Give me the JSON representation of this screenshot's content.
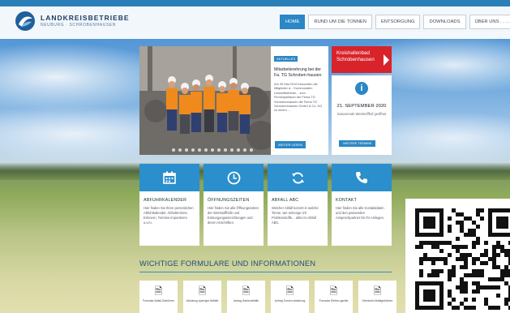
{
  "header": {
    "logo_title": "LANDKREISBETRIEBE",
    "logo_subtitle": "NEUBURG · SCHROBENHAUSEN"
  },
  "nav": [
    {
      "label": "HOME",
      "active": true
    },
    {
      "label": "RUND UM DIE TONNEN",
      "active": false
    },
    {
      "label": "ENTSORGUNG",
      "active": false
    },
    {
      "label": "DOWNLOADS",
      "active": false
    },
    {
      "label": "ÜBER UNS . . . . . . .",
      "active": false
    }
  ],
  "news": {
    "tag": "AKTUELLES",
    "title": "Mitarbeiterehrung bei der Fa. TG Schroben-hausen",
    "text": "Am 30 Mai 2019 besuchten die Mitglieder d... Kommunalen Umweltbetriebe... zum Firmenjubiläum der Firma TG Schrobenhausen die Firma TG Schrobenhausen GmbH & Co. KG zu einem ..."
  },
  "news_button": "WEITER LESEN",
  "cta": {
    "label": "Kreishallenbad Schrobenhausen"
  },
  "event": {
    "icon": "info-icon",
    "date": "21. SEPTEMBER 2020",
    "text": "Saisonende Wertstoffhof geöffnet",
    "button": "WEITERE TERMINE"
  },
  "tiles": [
    {
      "icon": "calendar-icon",
      "title": "ABFUHRKALENDER",
      "text": "Hier finden Sie Ihren persönlichen Abfuhrkalender, Abholtermine, Erinnern, Termine importieren u.v.m."
    },
    {
      "icon": "clock-icon",
      "title": "ÖFFNUNGSZEITEN",
      "text": "Hier finden Sie alle Öffnungszeiten der Wertstoffhöfe und Entsorgungseinrichtungen und deren Anschriften."
    },
    {
      "icon": "refresh-icon",
      "title": "ABFALL ABC",
      "text": "Welcher Abfall kommt in welche Tonne, wie entsorge ich Problemstoffe... alles im Abfall ABC."
    },
    {
      "icon": "phone-icon",
      "title": "KONTAKT",
      "text": "Hier finden Sie alle Kontaktdaten und den passenden Ansprechpartner für Ihr Anliegen."
    }
  ],
  "forms_title": "WICHTIGE FORMULARE UND INFORMATIONEN",
  "forms": [
    {
      "label": "Formular Abfall-Gebühren"
    },
    {
      "label": "Abholung sperriger Abfälle"
    },
    {
      "label": "Antrag Gartenabfälle"
    },
    {
      "label": "Antrag Tonnen-änderung"
    },
    {
      "label": "Formular Elektro-geräte"
    },
    {
      "label": "Übersicht Abfallgebühren"
    }
  ],
  "colors": {
    "accent": "#2b87c5",
    "cta": "#d8232a",
    "tile_header": "#2a8fcc"
  }
}
